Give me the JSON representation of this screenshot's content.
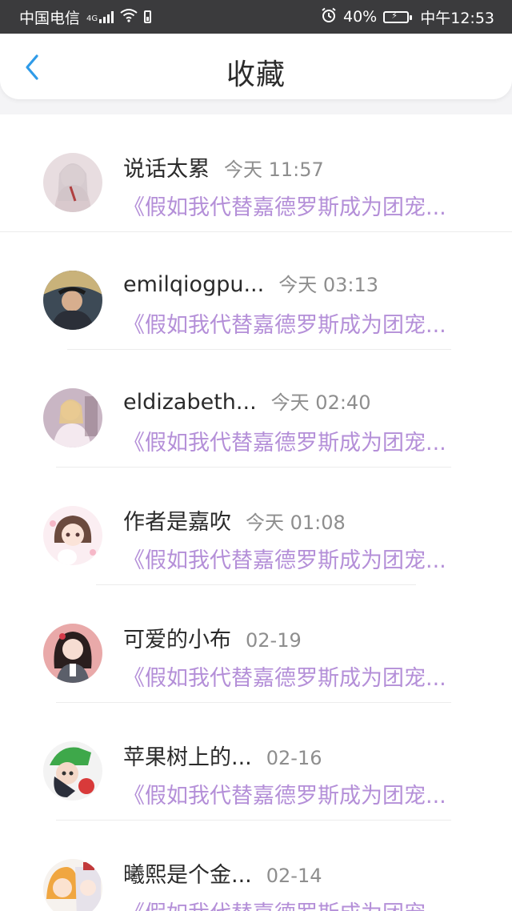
{
  "status_bar": {
    "carrier": "中国电信",
    "network": "4G",
    "battery_percent": "40%",
    "time": "中午12:53",
    "icons": [
      "signal-icon",
      "wifi-icon",
      "sim-battery-icon",
      "alarm-icon",
      "battery-charging-icon"
    ]
  },
  "header": {
    "back_icon": "chevron-left-icon",
    "title": "收藏",
    "accent_color": "#2f9be8"
  },
  "colors": {
    "preview_text": "#b48fd8",
    "name_text": "#2a2a2a",
    "time_text": "#8e8e8e"
  },
  "favorites": [
    {
      "name": "说话太累",
      "time": "今天 11:57",
      "preview": "《假如我代替嘉德罗斯成为团宠..."
    },
    {
      "name": "emilqiogpu...",
      "time": "今天 03:13",
      "preview": "《假如我代替嘉德罗斯成为团宠..."
    },
    {
      "name": "eldizabeth...",
      "time": "今天 02:40",
      "preview": "《假如我代替嘉德罗斯成为团宠..."
    },
    {
      "name": "作者是嘉吹",
      "time": "今天 01:08",
      "preview": "《假如我代替嘉德罗斯成为团宠..."
    },
    {
      "name": "可爱的小布",
      "time": "02-19",
      "preview": "《假如我代替嘉德罗斯成为团宠..."
    },
    {
      "name": "苹果树上的...",
      "time": "02-16",
      "preview": "《假如我代替嘉德罗斯成为团宠..."
    },
    {
      "name": "曦熙是个金...",
      "time": "02-14",
      "preview": "《假如我代替嘉德罗斯成为团宠..."
    }
  ]
}
